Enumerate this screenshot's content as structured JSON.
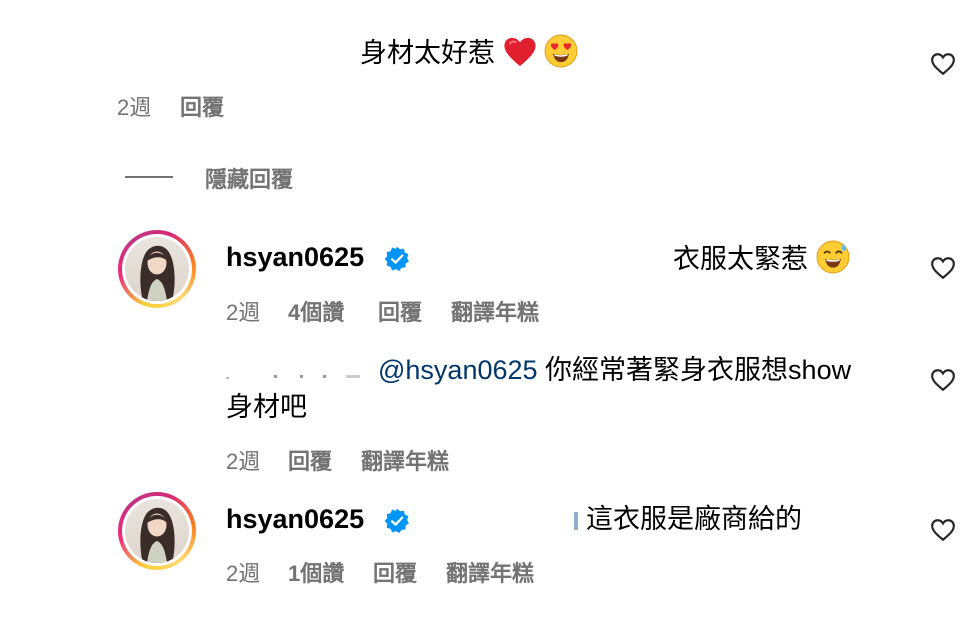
{
  "comment1": {
    "text": "身材太好惹",
    "time": "2週",
    "reply": "回覆"
  },
  "hide_replies": "隱藏回覆",
  "reply1": {
    "username": "hsyan0625",
    "text": "衣服太緊惹",
    "time": "2週",
    "likes": "4個讚",
    "reply": "回覆",
    "translate": "翻譯年糕"
  },
  "reply2": {
    "mention": "@hsyan0625",
    "text_line1": "你經常著緊身衣服想show",
    "text_line2": "身材吧",
    "time": "2週",
    "reply": "回覆",
    "translate": "翻譯年糕"
  },
  "reply3": {
    "username": "hsyan0625",
    "text": "這衣服是廠商給的",
    "time": "2週",
    "likes": "1個讚",
    "reply": "回覆",
    "translate": "翻譯年糕"
  },
  "icons": [
    "heart-outline-icon",
    "red-heart-emoji",
    "heart-eyes-emoji",
    "sweat-smile-emoji",
    "verified-badge-icon"
  ]
}
